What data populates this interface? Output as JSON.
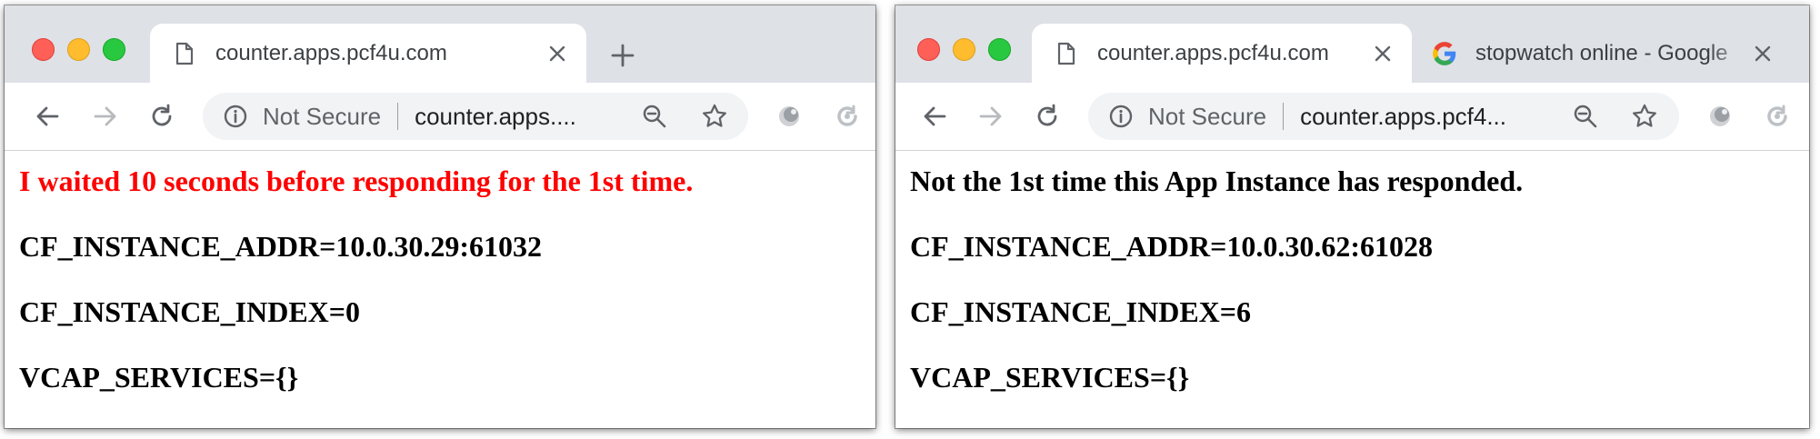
{
  "colors": {
    "tabstrip": "#dee1e6",
    "omnibox": "#f1f3f4",
    "warning_text": "#ff0000",
    "body_text": "#000000"
  },
  "left_window": {
    "tabs": [
      {
        "title": "counter.apps.pcf4u.com",
        "icon": "page-icon",
        "active": true
      }
    ],
    "omnibox": {
      "security_label": "Not Secure",
      "url": "counter.apps...."
    },
    "content": {
      "status_line": "I waited 10 seconds before responding for the 1st time.",
      "addr_line": "CF_INSTANCE_ADDR=10.0.30.29:61032",
      "index_line": "CF_INSTANCE_INDEX=0",
      "vcap_line": "VCAP_SERVICES={}"
    }
  },
  "right_window": {
    "tabs": [
      {
        "title": "counter.apps.pcf4u.com",
        "icon": "page-icon",
        "active": true
      },
      {
        "title": "stopwatch online - Google",
        "icon": "google-icon",
        "active": false
      }
    ],
    "omnibox": {
      "security_label": "Not Secure",
      "url": "counter.apps.pcf4..."
    },
    "content": {
      "status_line": "Not the 1st time this App Instance has responded.",
      "addr_line": "CF_INSTANCE_ADDR=10.0.30.62:61028",
      "index_line": "CF_INSTANCE_INDEX=6",
      "vcap_line": "VCAP_SERVICES={}"
    }
  }
}
